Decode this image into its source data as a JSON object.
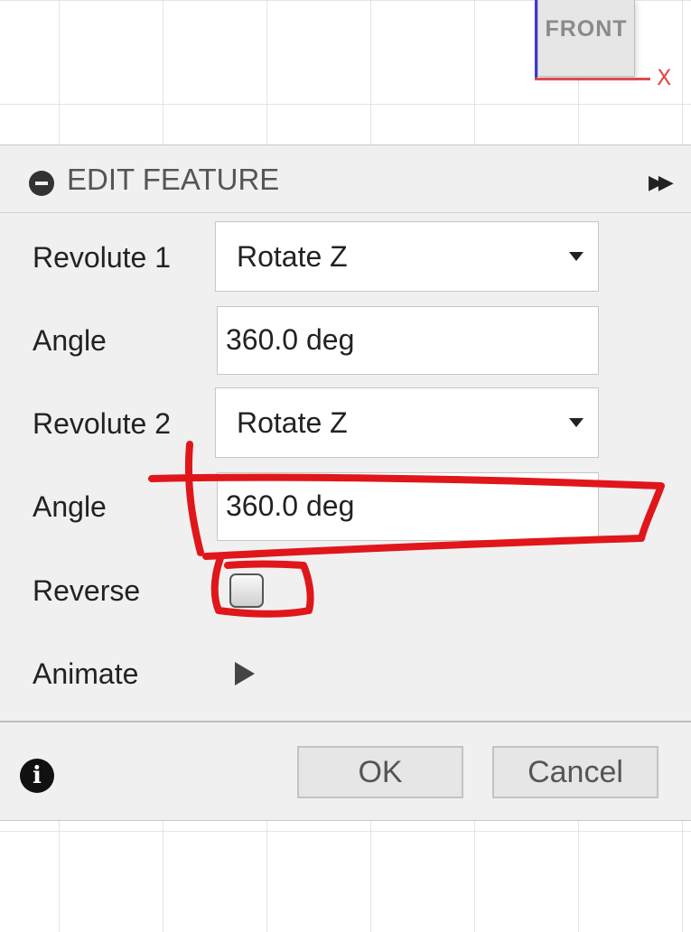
{
  "viewcube": {
    "face_label": "FRONT",
    "axis_label": "X"
  },
  "dialog": {
    "title": "EDIT FEATURE",
    "rows": [
      {
        "label": "Revolute 1",
        "type": "dropdown",
        "value": "Rotate Z"
      },
      {
        "label": "Angle",
        "type": "text",
        "value": "360.0 deg"
      },
      {
        "label": "Revolute 2",
        "type": "dropdown",
        "value": "Rotate Z"
      },
      {
        "label": "Angle",
        "type": "text",
        "value": "360.0 deg"
      },
      {
        "label": "Reverse",
        "type": "checkbox",
        "checked": false
      },
      {
        "label": "Animate",
        "type": "play"
      }
    ],
    "ok_label": "OK",
    "cancel_label": "Cancel",
    "icons": [
      "collapse-icon",
      "expand-icon",
      "dropdown-caret-icon",
      "play-icon",
      "info-icon"
    ]
  },
  "annotation": {
    "color": "#e0161b"
  }
}
